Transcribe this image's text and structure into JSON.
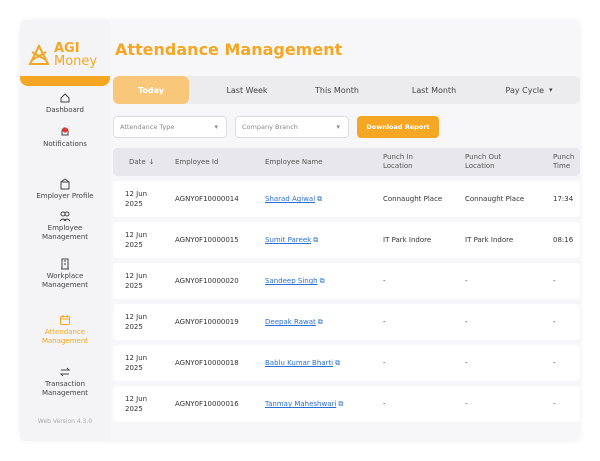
{
  "app": {
    "logo_line1": "AGI",
    "logo_line2": "Money",
    "version": "Web Version 4.3.0",
    "accent_color": "#f5a623"
  },
  "sidebar": {
    "items": [
      {
        "label": "Dashboard",
        "icon": "home-icon"
      },
      {
        "label": "Notifications",
        "icon": "bell-icon"
      },
      {
        "label": "Employer Profile",
        "icon": "building-icon"
      },
      {
        "label": "Employee Management",
        "icon": "users-icon"
      },
      {
        "label": "Workplace Management",
        "icon": "office-icon"
      },
      {
        "label": "Attendance Management",
        "icon": "calendar-icon",
        "active": true
      },
      {
        "label": "Transaction Management",
        "icon": "swap-icon"
      }
    ]
  },
  "page": {
    "title": "Attendance Management"
  },
  "tabs": [
    {
      "label": "Today",
      "active": true
    },
    {
      "label": "Last Week"
    },
    {
      "label": "This Month"
    },
    {
      "label": "Last Month"
    },
    {
      "label": "Pay Cycle"
    }
  ],
  "filters": {
    "attendance_type": "Attendance Type",
    "company_branch": "Company Branch",
    "download_label": "Download Report"
  },
  "table": {
    "columns": [
      "Date",
      "Employee Id",
      "Employee Name",
      "Punch In Location",
      "Punch Out Location",
      "Punch Time"
    ],
    "rows": [
      {
        "date": "12 Jun 2025",
        "id": "AGNY0F10000014",
        "name": "Sharad Agiwal",
        "in": "Connaught Place",
        "out": "Connaught Place",
        "time": "17:34"
      },
      {
        "date": "12 Jun 2025",
        "id": "AGNY0F10000015",
        "name": "Sumit Pareek",
        "in": "IT Park Indore",
        "out": "IT Park Indore",
        "time": "08:16"
      },
      {
        "date": "12 Jun 2025",
        "id": "AGNY0F10000020",
        "name": "Sandeep Singh",
        "in": "-",
        "out": "-",
        "time": "-"
      },
      {
        "date": "12 Jun 2025",
        "id": "AGNY0F10000019",
        "name": "Deepak Rawat",
        "in": "-",
        "out": "-",
        "time": "-"
      },
      {
        "date": "12 Jun 2025",
        "id": "AGNY0F10000018",
        "name": "Bablu Kumar Bharti",
        "in": "-",
        "out": "-",
        "time": "-"
      },
      {
        "date": "12 Jun 2025",
        "id": "AGNY0F10000016",
        "name": "Tanmay Maheshwari",
        "in": "-",
        "out": "-",
        "time": "-"
      }
    ]
  }
}
